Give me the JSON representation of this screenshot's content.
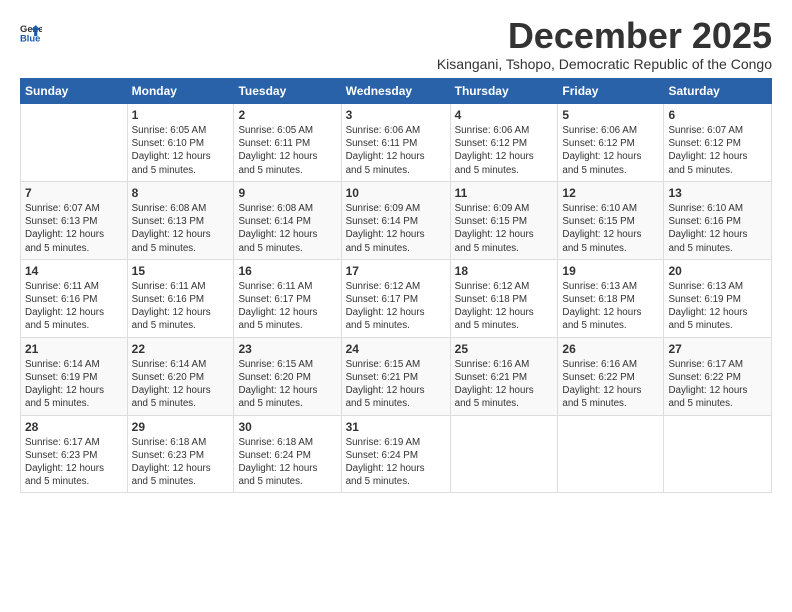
{
  "logo": {
    "line1": "General",
    "line2": "Blue"
  },
  "title": "December 2025",
  "subtitle": "Kisangani, Tshopo, Democratic Republic of the Congo",
  "days_of_week": [
    "Sunday",
    "Monday",
    "Tuesday",
    "Wednesday",
    "Thursday",
    "Friday",
    "Saturday"
  ],
  "weeks": [
    [
      {
        "day": "",
        "info": ""
      },
      {
        "day": "1",
        "info": "Sunrise: 6:05 AM\nSunset: 6:10 PM\nDaylight: 12 hours\nand 5 minutes."
      },
      {
        "day": "2",
        "info": "Sunrise: 6:05 AM\nSunset: 6:11 PM\nDaylight: 12 hours\nand 5 minutes."
      },
      {
        "day": "3",
        "info": "Sunrise: 6:06 AM\nSunset: 6:11 PM\nDaylight: 12 hours\nand 5 minutes."
      },
      {
        "day": "4",
        "info": "Sunrise: 6:06 AM\nSunset: 6:12 PM\nDaylight: 12 hours\nand 5 minutes."
      },
      {
        "day": "5",
        "info": "Sunrise: 6:06 AM\nSunset: 6:12 PM\nDaylight: 12 hours\nand 5 minutes."
      },
      {
        "day": "6",
        "info": "Sunrise: 6:07 AM\nSunset: 6:12 PM\nDaylight: 12 hours\nand 5 minutes."
      }
    ],
    [
      {
        "day": "7",
        "info": "Sunrise: 6:07 AM\nSunset: 6:13 PM\nDaylight: 12 hours\nand 5 minutes."
      },
      {
        "day": "8",
        "info": "Sunrise: 6:08 AM\nSunset: 6:13 PM\nDaylight: 12 hours\nand 5 minutes."
      },
      {
        "day": "9",
        "info": "Sunrise: 6:08 AM\nSunset: 6:14 PM\nDaylight: 12 hours\nand 5 minutes."
      },
      {
        "day": "10",
        "info": "Sunrise: 6:09 AM\nSunset: 6:14 PM\nDaylight: 12 hours\nand 5 minutes."
      },
      {
        "day": "11",
        "info": "Sunrise: 6:09 AM\nSunset: 6:15 PM\nDaylight: 12 hours\nand 5 minutes."
      },
      {
        "day": "12",
        "info": "Sunrise: 6:10 AM\nSunset: 6:15 PM\nDaylight: 12 hours\nand 5 minutes."
      },
      {
        "day": "13",
        "info": "Sunrise: 6:10 AM\nSunset: 6:16 PM\nDaylight: 12 hours\nand 5 minutes."
      }
    ],
    [
      {
        "day": "14",
        "info": "Sunrise: 6:11 AM\nSunset: 6:16 PM\nDaylight: 12 hours\nand 5 minutes."
      },
      {
        "day": "15",
        "info": "Sunrise: 6:11 AM\nSunset: 6:16 PM\nDaylight: 12 hours\nand 5 minutes."
      },
      {
        "day": "16",
        "info": "Sunrise: 6:11 AM\nSunset: 6:17 PM\nDaylight: 12 hours\nand 5 minutes."
      },
      {
        "day": "17",
        "info": "Sunrise: 6:12 AM\nSunset: 6:17 PM\nDaylight: 12 hours\nand 5 minutes."
      },
      {
        "day": "18",
        "info": "Sunrise: 6:12 AM\nSunset: 6:18 PM\nDaylight: 12 hours\nand 5 minutes."
      },
      {
        "day": "19",
        "info": "Sunrise: 6:13 AM\nSunset: 6:18 PM\nDaylight: 12 hours\nand 5 minutes."
      },
      {
        "day": "20",
        "info": "Sunrise: 6:13 AM\nSunset: 6:19 PM\nDaylight: 12 hours\nand 5 minutes."
      }
    ],
    [
      {
        "day": "21",
        "info": "Sunrise: 6:14 AM\nSunset: 6:19 PM\nDaylight: 12 hours\nand 5 minutes."
      },
      {
        "day": "22",
        "info": "Sunrise: 6:14 AM\nSunset: 6:20 PM\nDaylight: 12 hours\nand 5 minutes."
      },
      {
        "day": "23",
        "info": "Sunrise: 6:15 AM\nSunset: 6:20 PM\nDaylight: 12 hours\nand 5 minutes."
      },
      {
        "day": "24",
        "info": "Sunrise: 6:15 AM\nSunset: 6:21 PM\nDaylight: 12 hours\nand 5 minutes."
      },
      {
        "day": "25",
        "info": "Sunrise: 6:16 AM\nSunset: 6:21 PM\nDaylight: 12 hours\nand 5 minutes."
      },
      {
        "day": "26",
        "info": "Sunrise: 6:16 AM\nSunset: 6:22 PM\nDaylight: 12 hours\nand 5 minutes."
      },
      {
        "day": "27",
        "info": "Sunrise: 6:17 AM\nSunset: 6:22 PM\nDaylight: 12 hours\nand 5 minutes."
      }
    ],
    [
      {
        "day": "28",
        "info": "Sunrise: 6:17 AM\nSunset: 6:23 PM\nDaylight: 12 hours\nand 5 minutes."
      },
      {
        "day": "29",
        "info": "Sunrise: 6:18 AM\nSunset: 6:23 PM\nDaylight: 12 hours\nand 5 minutes."
      },
      {
        "day": "30",
        "info": "Sunrise: 6:18 AM\nSunset: 6:24 PM\nDaylight: 12 hours\nand 5 minutes."
      },
      {
        "day": "31",
        "info": "Sunrise: 6:19 AM\nSunset: 6:24 PM\nDaylight: 12 hours\nand 5 minutes."
      },
      {
        "day": "",
        "info": ""
      },
      {
        "day": "",
        "info": ""
      },
      {
        "day": "",
        "info": ""
      }
    ]
  ]
}
